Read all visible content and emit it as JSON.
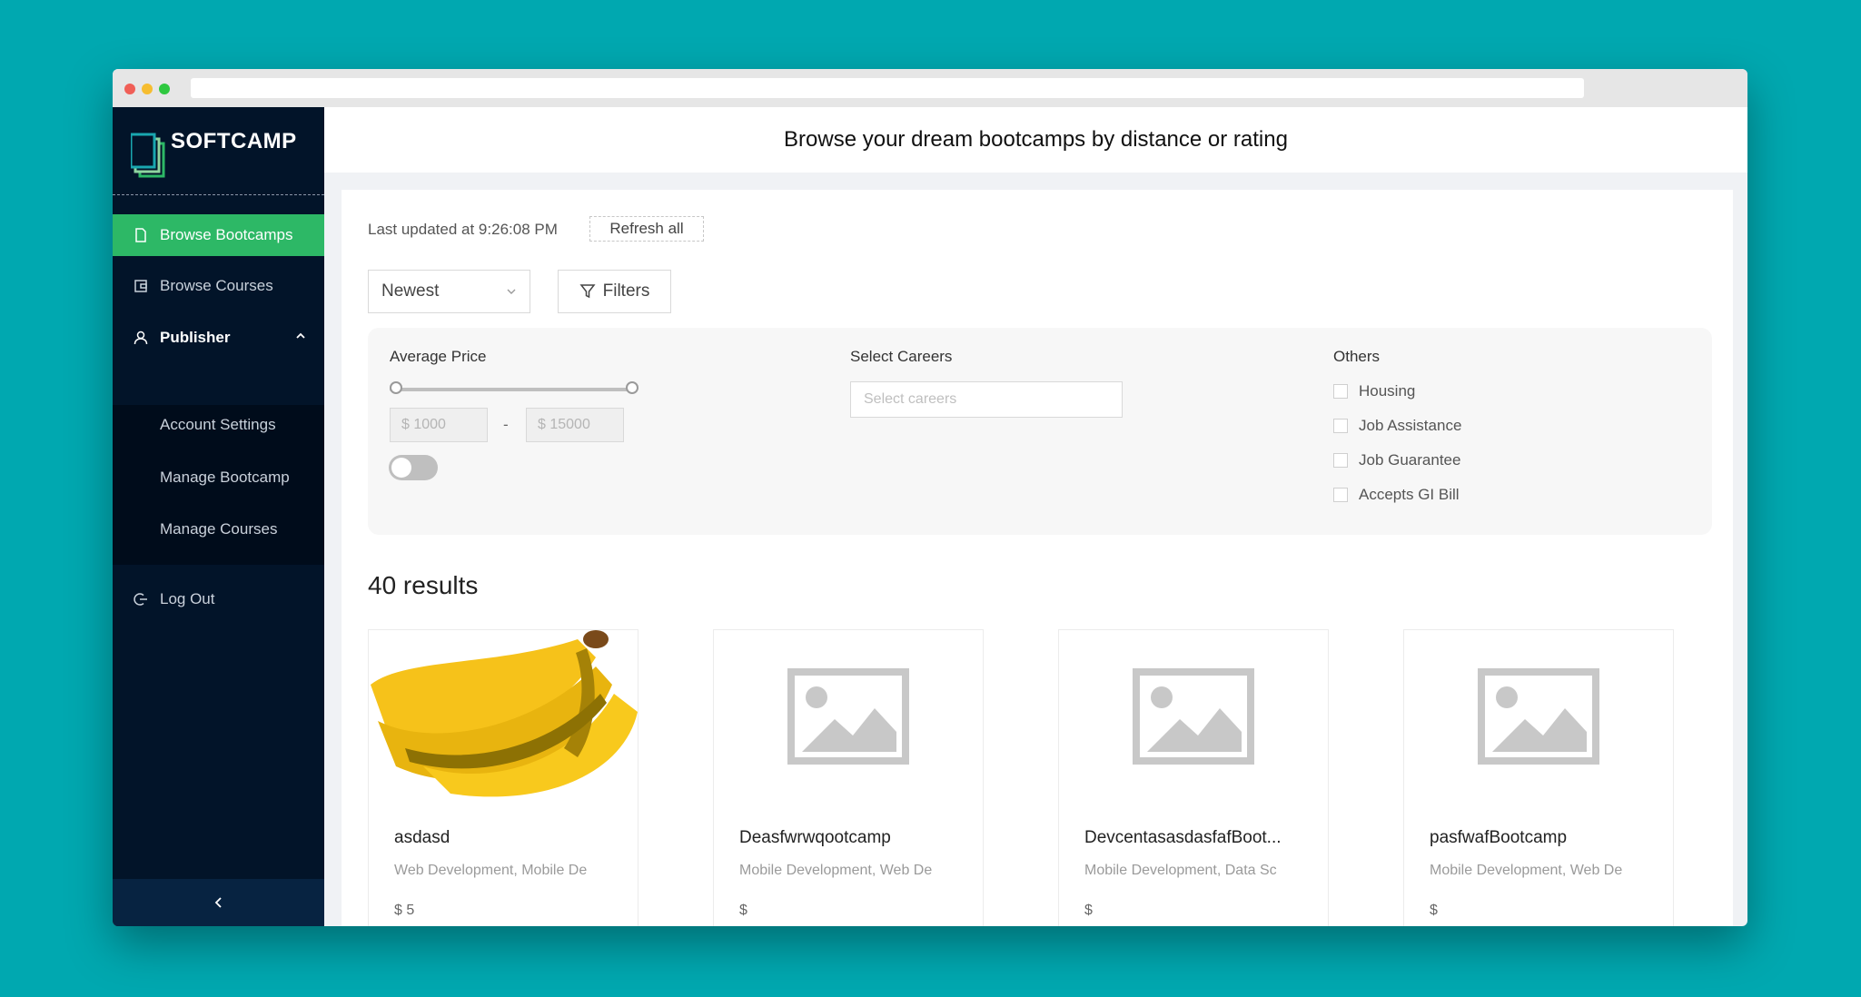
{
  "sidebar": {
    "logo_text": "SOFTCAMP",
    "items": [
      {
        "label": "Browse Bootcamps"
      },
      {
        "label": "Browse Courses"
      },
      {
        "label": "Publisher"
      },
      {
        "label": "Log Out"
      }
    ],
    "submenu": [
      {
        "label": "Account Settings"
      },
      {
        "label": "Manage Bootcamp"
      },
      {
        "label": "Manage Courses"
      }
    ],
    "collapse_icon": "chevron-left-icon"
  },
  "header": {
    "title": "Browse your dream bootcamps by distance or rating"
  },
  "toolbar": {
    "updated": "Last updated at 9:26:08 PM",
    "refresh_label": "Refresh all",
    "sort_value": "Newest",
    "filters_label": "Filters"
  },
  "filters": {
    "price_label": "Average Price",
    "min_placeholder": "$ 1000",
    "max_placeholder": "$ 15000",
    "dash": "-",
    "careers_label": "Select Careers",
    "careers_placeholder": "Select careers",
    "others_label": "Others",
    "others": [
      {
        "label": "Housing"
      },
      {
        "label": "Job Assistance"
      },
      {
        "label": "Job Guarantee"
      },
      {
        "label": "Accepts GI Bill"
      }
    ]
  },
  "results": {
    "count_label": "40 results"
  },
  "cards": [
    {
      "name": "asdasd",
      "tags": "Web Development, Mobile De",
      "price": "$ 5",
      "image": "banana"
    },
    {
      "name": "Deasfwrwqootcamp",
      "tags": "Mobile Development, Web De",
      "price": "$",
      "image": "placeholder"
    },
    {
      "name": "DevcentasasdasfafBoot...",
      "tags": "Mobile Development, Data Sc",
      "price": "$",
      "image": "placeholder"
    },
    {
      "name": "pasfwafBootcamp",
      "tags": "Mobile Development, Web De",
      "price": "$",
      "image": "placeholder"
    }
  ],
  "colors": {
    "sidebar_bg": "#021429",
    "active_green": "#2db866",
    "background_teal": "#00a8b0"
  }
}
